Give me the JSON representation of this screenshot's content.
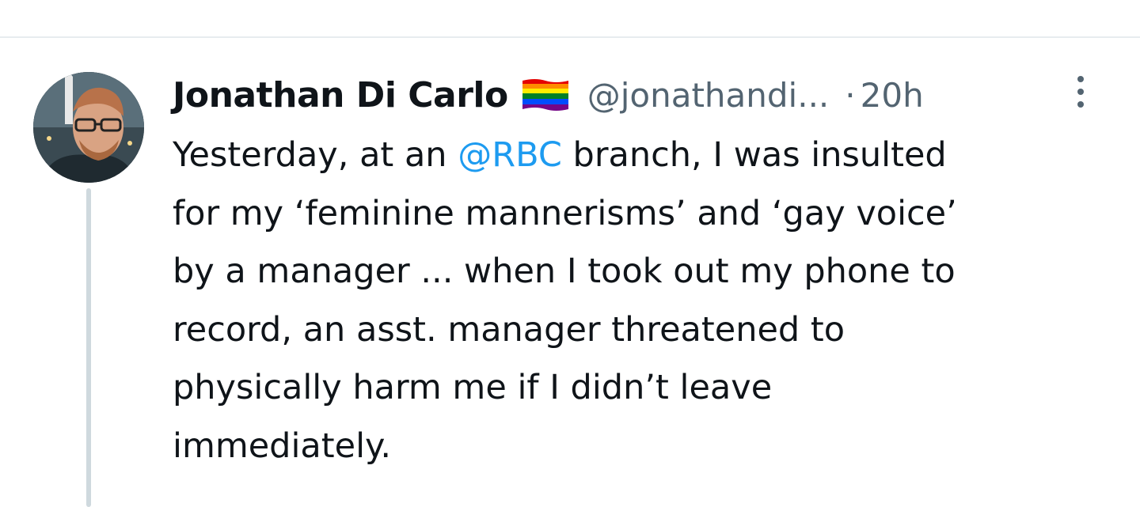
{
  "header_divider": true,
  "tweet": {
    "author_name": "Jonathan Di Carlo",
    "author_badge_icon": "rainbow-flag-icon",
    "handle": "@jonathandi...",
    "separator": "·",
    "timestamp": "20h",
    "more_icon": "more-vertical-icon",
    "avatar_icon": "avatar-photo",
    "body": {
      "line1_before": "Yesterday, at an ",
      "line1_mention": "@RBC",
      "line1_after": " branch, I was insulted",
      "line2": "for my ‘feminine mannerisms’ and ‘gay voice’",
      "line3": "by a manager ... when I took out my phone to",
      "line4": "record, an asst. manager threatened to",
      "line5": "physically harm me if I didn’t leave",
      "line6": "immediately."
    }
  },
  "colors": {
    "text_primary": "#0f1419",
    "text_secondary": "#536471",
    "mention": "#1d9bf0",
    "thread_line": "#cfd9de",
    "divider": "#e7ecef"
  }
}
